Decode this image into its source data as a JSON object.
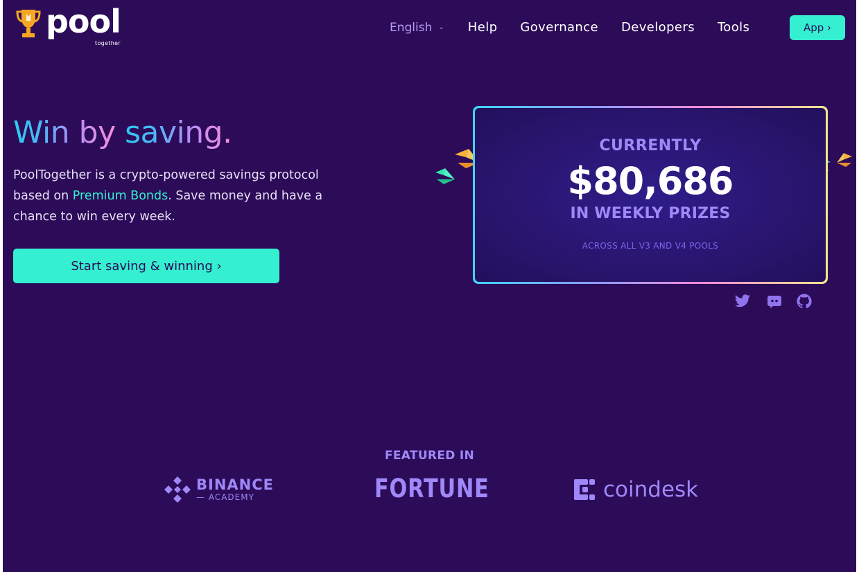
{
  "header": {
    "logo_text": "pool",
    "logo_subtext": "together",
    "language": "English",
    "nav": [
      {
        "label": "Help"
      },
      {
        "label": "Governance"
      },
      {
        "label": "Developers"
      },
      {
        "label": "Tools"
      }
    ],
    "app_button": "App ›"
  },
  "hero": {
    "title_part1": "Win by",
    "title_part2": "saving.",
    "description_before": "PoolTogether is a crypto-powered savings protocol based on ",
    "description_link": "Premium Bonds",
    "description_after": ". Save money and have a chance to win every week.",
    "cta": "Start saving & winning ›"
  },
  "prize_card": {
    "line1": "CURRENTLY",
    "amount": "$80,686",
    "line2": "IN WEEKLY PRIZES",
    "note": "ACROSS ALL V3 AND V4 POOLS"
  },
  "social": {
    "icons": [
      "twitter-icon",
      "discord-icon",
      "github-icon"
    ]
  },
  "featured": {
    "label": "FEATURED IN",
    "binance_line1": "BINANCE",
    "binance_line2": "— ACADEMY",
    "fortune": "FORTUNE",
    "coindesk": "coindesk"
  },
  "colors": {
    "background": "#2c0b58",
    "accent_teal": "#35f0d0",
    "muted_purple": "#9f88f7",
    "trophy_gold": "#f5a623"
  }
}
